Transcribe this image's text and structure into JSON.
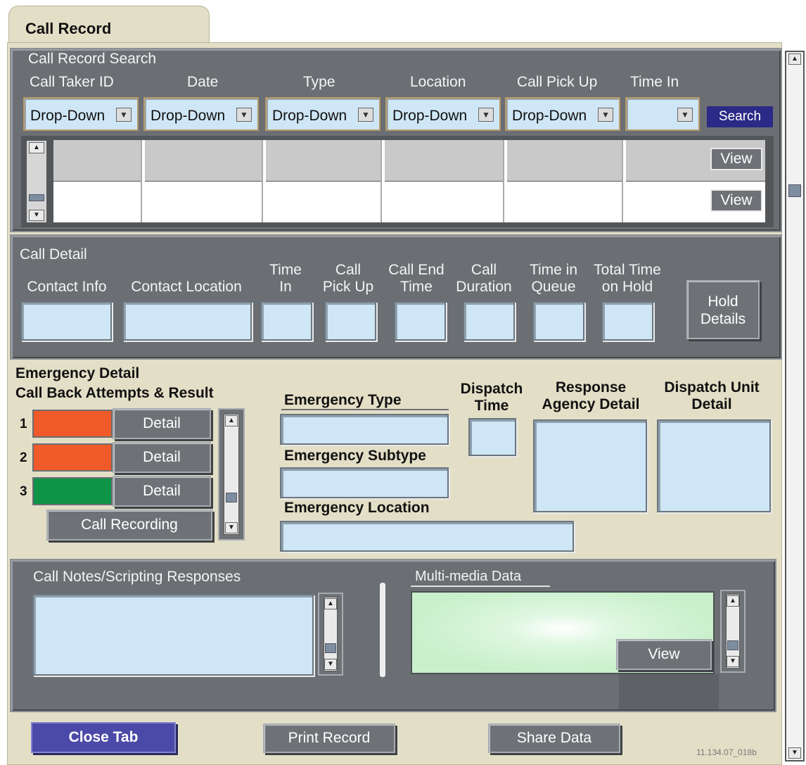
{
  "tab": {
    "title": "Call Record"
  },
  "search": {
    "section_title": "Call Record Search",
    "columns": [
      "Call Taker ID",
      "Date",
      "Type",
      "Location",
      "Call Pick Up",
      "Time In"
    ],
    "dropdown_value": "Drop-Down",
    "search_label": "Search",
    "view_label": "View"
  },
  "call_detail": {
    "title": "Call Detail",
    "fields": [
      {
        "line1": "",
        "line2": "Contact Info"
      },
      {
        "line1": "",
        "line2": "Contact Location"
      },
      {
        "line1": "Time",
        "line2": "In"
      },
      {
        "line1": "Call",
        "line2": "Pick Up"
      },
      {
        "line1": "Call End",
        "line2": "Time"
      },
      {
        "line1": "Call",
        "line2": "Duration"
      },
      {
        "line1": "Time in",
        "line2": "Queue"
      },
      {
        "line1": "Total Time",
        "line2": "on Hold"
      }
    ],
    "hold_details_line1": "Hold",
    "hold_details_line2": "Details"
  },
  "emergency": {
    "title": "Emergency Detail",
    "callback_title": "Call Back Attempts & Result",
    "attempts": [
      {
        "num": "1",
        "color": "#f05a28"
      },
      {
        "num": "2",
        "color": "#f05a28"
      },
      {
        "num": "3",
        "color": "#0e9447"
      }
    ],
    "detail_label": "Detail",
    "call_recording_label": "Call Recording",
    "type_label": "Emergency Type",
    "subtype_label": "Emergency Subtype",
    "location_label": "Emergency Location",
    "dispatch_time_l1": "Dispatch",
    "dispatch_time_l2": "Time",
    "response_l1": "Response",
    "response_l2": "Agency Detail",
    "unit_l1": "Dispatch Unit",
    "unit_l2": "Detail"
  },
  "notes": {
    "title": "Call Notes/Scripting Responses",
    "media_title": "Multi-media Data",
    "view_label": "View"
  },
  "footer": {
    "close_tab": "Close Tab",
    "print_record": "Print Record",
    "share_data": "Share Data",
    "figure_id": "11.134.07_018b"
  },
  "colors": {
    "panel": "#6b6e72",
    "field": "#cfe6f6",
    "close_button": "#4b4aa8",
    "search_button": "#2b2a86"
  },
  "icons": [
    "scroll-up-arrow-icon",
    "scroll-down-arrow-icon",
    "dropdown-arrow-icon"
  ]
}
